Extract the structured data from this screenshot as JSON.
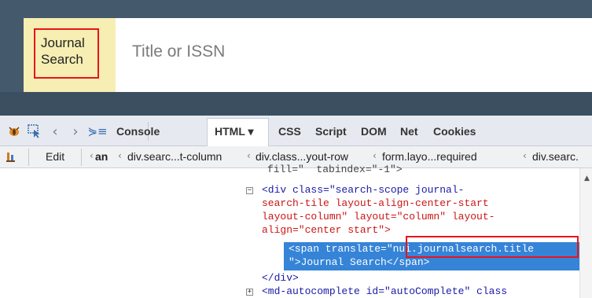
{
  "search": {
    "scope_label": "Journal\nSearch",
    "placeholder": "Title or ISSN"
  },
  "devtools": {
    "tabs": [
      "Console",
      "HTML ▾",
      "CSS",
      "Script",
      "DOM",
      "Net",
      "Cookies"
    ],
    "active_tab": "HTML",
    "icons": [
      "firebug-icon",
      "inspect-icon",
      "back-icon",
      "forward-icon",
      "command-icon"
    ],
    "breadcrumb": {
      "edit_label": "Edit",
      "items": [
        "an",
        "div.searc...t-column",
        "div.class...yout-row",
        "form.layo...required",
        "div.searc."
      ]
    },
    "tree": {
      "clipped_line": "fill=\"  tabindex=\"-1\">",
      "div_line1": "<div class=\"search-scope journal-",
      "div_line2": "search-tile layout-align-center-start",
      "div_line3": "layout-column\" layout=\"column\" layout-",
      "div_line4": "align=\"center start\">",
      "span_line1": "<span translate=\"nui.journalsearch.title",
      "span_line2": "\">Journal Search</span>",
      "close_div": "</div>",
      "md_line": "<md-autocomplete id=\"autoComplete\" class"
    }
  },
  "colors": {
    "app_bg": "#44596c",
    "scope_tile": "#f6eeb2",
    "highlight_red": "#e8151b",
    "selection_blue": "#3584d8"
  }
}
